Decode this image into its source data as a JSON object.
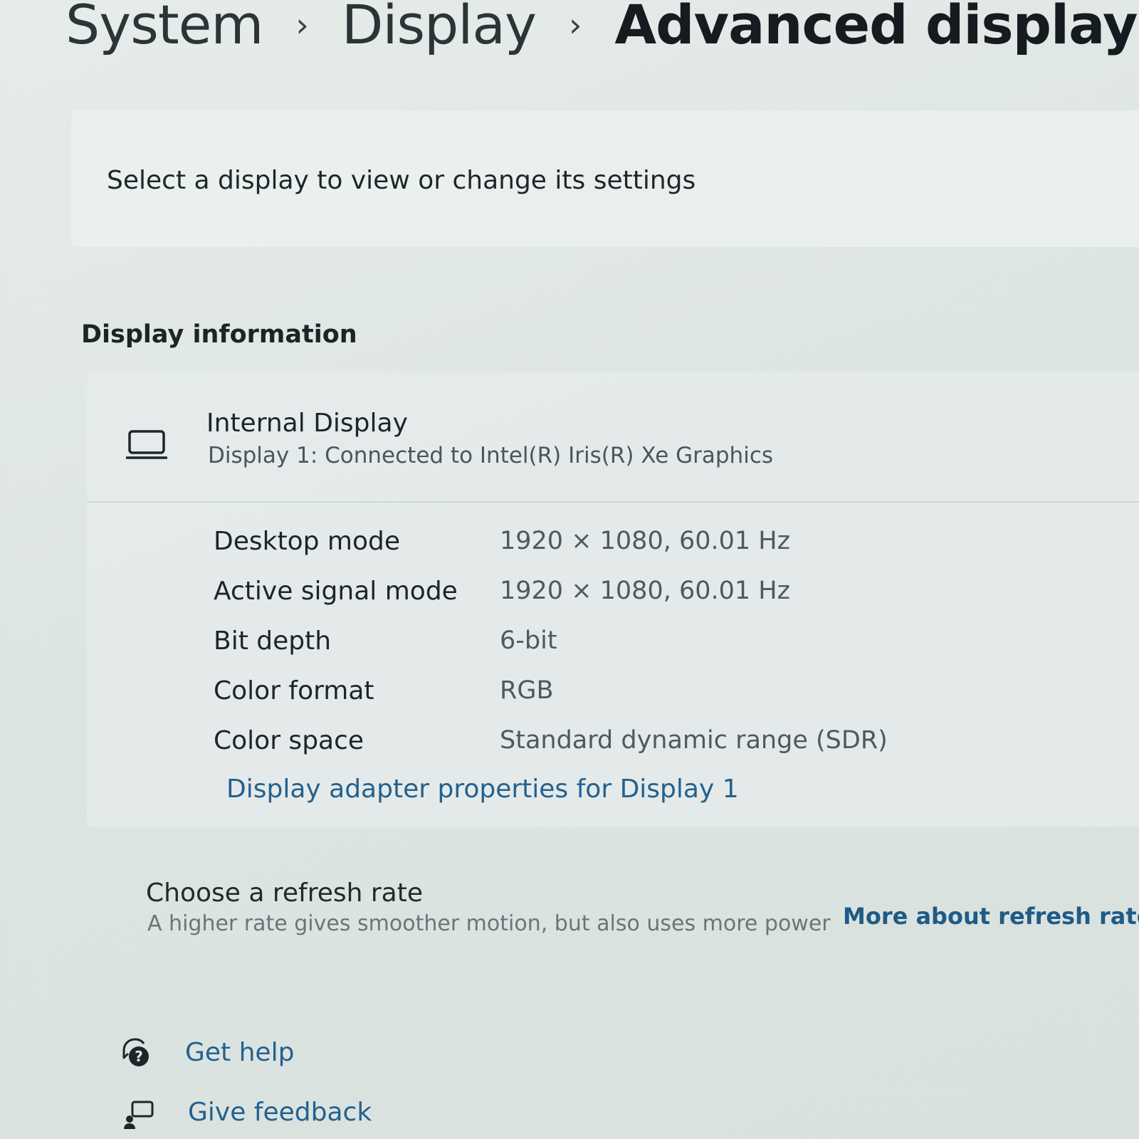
{
  "breadcrumb": {
    "items": [
      "System",
      "Display",
      "Advanced display"
    ],
    "separator": "›"
  },
  "select_display": {
    "text": "Select a display to view or change its settings"
  },
  "display_information": {
    "heading": "Display information",
    "display_name": "Internal Display",
    "display_subtitle": "Display 1: Connected to Intel(R) Iris(R) Xe Graphics",
    "icon": "laptop-icon",
    "properties": [
      {
        "label": "Desktop mode",
        "value": "1920 × 1080, 60.01 Hz"
      },
      {
        "label": "Active signal mode",
        "value": "1920 × 1080, 60.01 Hz"
      },
      {
        "label": "Bit depth",
        "value": "6-bit"
      },
      {
        "label": "Color format",
        "value": "RGB"
      },
      {
        "label": "Color space",
        "value": "Standard dynamic range (SDR)"
      }
    ],
    "adapter_link": "Display adapter properties for Display 1"
  },
  "refresh_rate": {
    "title": "Choose a refresh rate",
    "description": "A higher rate gives smoother motion, but also uses more power",
    "link": "More about refresh rate"
  },
  "footer": {
    "get_help": "Get help",
    "get_help_icon": "help-icon",
    "give_feedback": "Give feedback",
    "give_feedback_icon": "feedback-icon"
  },
  "colors": {
    "link": "#23618f",
    "background": "#dde5e3",
    "text": "#1f2a2d"
  }
}
